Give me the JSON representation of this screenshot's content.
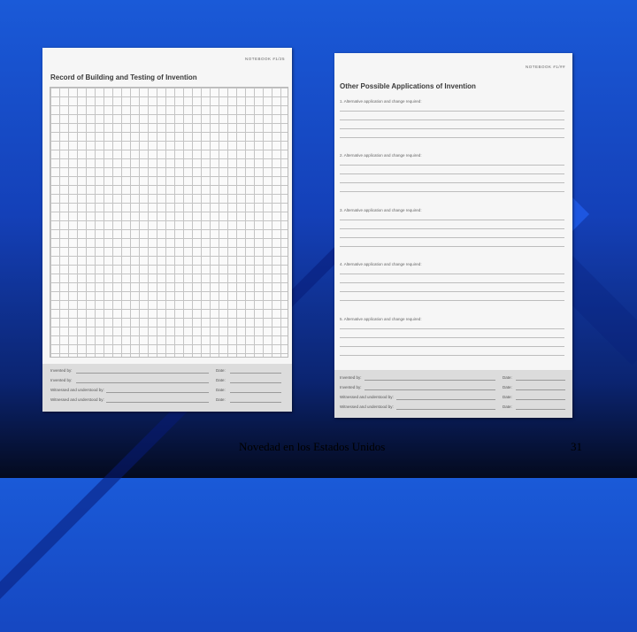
{
  "slide": {
    "caption": "Novedad en los Estados Unidos",
    "page_number": "31"
  },
  "left_page": {
    "header": "NOTEBOOK #1/25",
    "title": "Record of Building and Testing of Invention",
    "signatures": [
      {
        "label": "Invented by:",
        "date": "Date:"
      },
      {
        "label": "Invented by:",
        "date": "Date:"
      },
      {
        "label": "Witnessed and understood by:",
        "date": "Date:"
      },
      {
        "label": "Witnessed and understood by:",
        "date": "Date:"
      }
    ]
  },
  "right_page": {
    "header": "NOTEBOOK #1/##",
    "title": "Other Possible Applications of Invention",
    "questions": [
      "1. Alternative application and change required:",
      "2. Alternative application and change required:",
      "3. Alternative application and change required:",
      "4. Alternative application and change required:",
      "5. Alternative application and change required:"
    ],
    "signatures": [
      {
        "label": "Invented by:",
        "date": "Date:"
      },
      {
        "label": "Invented by:",
        "date": "Date:"
      },
      {
        "label": "Witnessed and understood by:",
        "date": "Date:"
      },
      {
        "label": "Witnessed and understood by:",
        "date": "Date:"
      }
    ]
  }
}
